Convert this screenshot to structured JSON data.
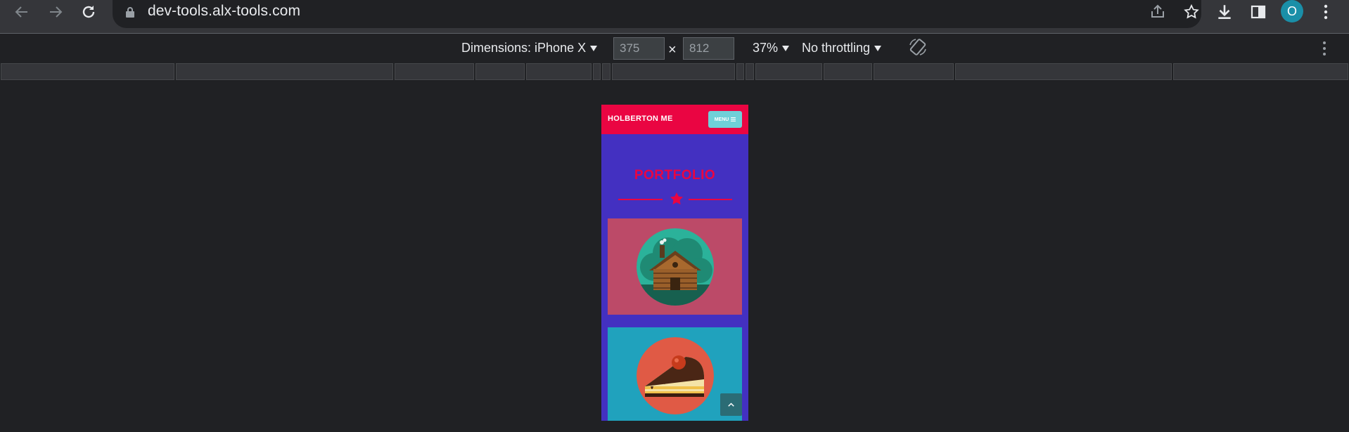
{
  "browser": {
    "url": "dev-tools.alx-tools.com",
    "profile_initial": "O"
  },
  "device_toolbar": {
    "dimensions_label": "Dimensions: iPhone X",
    "width": "375",
    "height": "812",
    "times": "×",
    "zoom": "37%",
    "throttling": "No throttling"
  },
  "site": {
    "brand": "HOLBERTON ME",
    "menu_label": "MENU",
    "heading": "PORTFOLIO"
  },
  "colors": {
    "header": "#ea0542",
    "page_bg": "#4330c1",
    "menu_button": "#6fd0d8",
    "card_1": "#bc4a68",
    "card_2": "#20a2bd"
  },
  "icons": {
    "back": "arrow-left-icon",
    "forward": "arrow-right-icon",
    "reload": "reload-icon",
    "lock": "lock-icon",
    "share": "share-icon",
    "bookmark": "star-icon",
    "download": "download-icon",
    "side_panel": "side-panel-icon",
    "menu": "kebab-icon",
    "rotate": "rotate-icon",
    "portfolio_1": "cabin-icon",
    "portfolio_2": "cake-icon",
    "scroll_top": "chevron-up-icon"
  }
}
